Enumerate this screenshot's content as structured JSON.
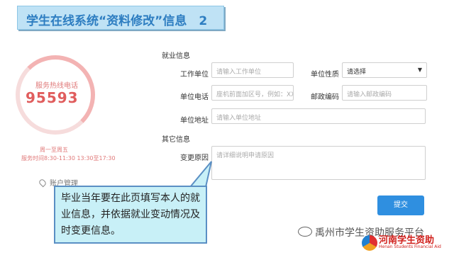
{
  "slide_title": "学生在线系统“资料修改”信息　2",
  "sidebar": {
    "service_label": "服务热线电话",
    "service_number": "95593",
    "hours_line1": "周一至周五",
    "hours_line2": "服务时间8:30-11:30 13:30至17:30",
    "account_menu": "账户管理"
  },
  "form": {
    "employment_section": "就业信息",
    "work_unit_label": "工作单位",
    "work_unit_placeholder": "请输入工作单位",
    "unit_nature_label": "单位性质",
    "unit_nature_value": "请选择",
    "unit_phone_label": "单位电话",
    "unit_phone_placeholder": "座机前面加区号，例如：XXXX-XXXX",
    "postcode_label": "邮政编码",
    "postcode_placeholder": "请输入邮政编码",
    "unit_address_label": "单位地址",
    "unit_address_placeholder": "请输入单位地址",
    "other_section": "其它信息",
    "reason_label": "变更原因",
    "reason_placeholder": "请详细说明申请原因",
    "submit_label": "提交"
  },
  "callout": {
    "text": "毕业当年要在此页填写本人的就业信息，并依据就业变动情况及时变更信息。"
  },
  "watermark": {
    "text": "禹州市学生资助服务平台",
    "logo_text": "河南学生资助",
    "logo_sub": "Henan Students Financial Aid"
  },
  "colors": {
    "title": "#2d7dc1",
    "accent_red": "#e05d5d",
    "submit": "#2f8fe0",
    "callout_bg": "#c8f0f7"
  }
}
